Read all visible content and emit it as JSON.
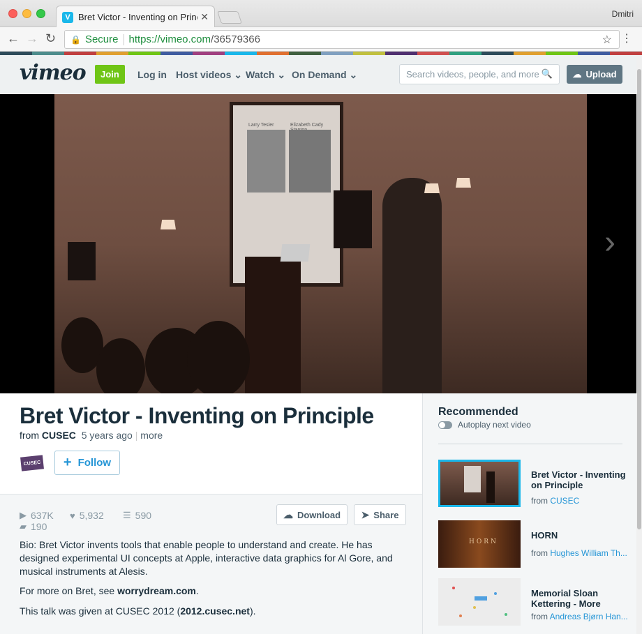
{
  "browser": {
    "tab_title": "Bret Victor - Inventing on Principle",
    "tab_favicon": "V",
    "user_name": "Dmitri",
    "secure_label": "Secure",
    "url_scheme_host": "https://vimeo.com",
    "url_path": "/36579366"
  },
  "header": {
    "logo": "vimeo",
    "join": "Join",
    "login": "Log in",
    "host_videos": "Host videos ⌄",
    "watch": "Watch ⌄",
    "on_demand": "On Demand ⌄",
    "search_placeholder": "Search videos, people, and more",
    "upload": "Upload"
  },
  "video": {
    "slide_caption_left": "Larry Tesler",
    "slide_caption_right": "Elizabeth Cady Stanton"
  },
  "info": {
    "title": "Bret Victor - Inventing on Principle",
    "from": "from",
    "channel": "CUSEC",
    "age": "5 years ago",
    "more": "more",
    "channel_logo_text": "CUSEC",
    "follow": "Follow"
  },
  "stats": {
    "plays": "637K",
    "likes": "5,932",
    "collections": "590",
    "comments": "190",
    "download": "Download",
    "share": "Share"
  },
  "description": {
    "bio": "Bio: Bret Victor invents tools that enable people to understand and create. He has designed experimental UI concepts at Apple, interactive data graphics for Al Gore, and musical instruments at Alesis.",
    "more_prefix": "For more on Bret, see ",
    "more_link": "worrydream.com",
    "more_suffix": ".",
    "talk_prefix": "This talk was given at CUSEC 2012 (",
    "talk_link": "2012.cusec.net",
    "talk_suffix": ")."
  },
  "recommended": {
    "title": "Recommended",
    "autoplay": "Autoplay next video",
    "items": [
      {
        "title": "Bret Victor - Inventing on Principle",
        "from": "from ",
        "author": "CUSEC"
      },
      {
        "title": "HORN",
        "from": "from ",
        "author": "Hughes William Th..."
      },
      {
        "title": "Memorial Sloan Kettering - More",
        "from": "from ",
        "author": "Andreas Bjørn Han..."
      }
    ],
    "horn_thumb_text": "HORN"
  },
  "colors": {
    "brand_green": "#6fc516",
    "link_blue": "#2495d6",
    "text_dark": "#1a2e3b",
    "stripe": [
      "#2d4b5a",
      "#4d8c8c",
      "#c04040",
      "#e0a030",
      "#6fc516",
      "#3f5ca0",
      "#a04080",
      "#1ab7ea",
      "#e07030",
      "#406040",
      "#80a0c0",
      "#c0c040",
      "#503070",
      "#d05050",
      "#30a080",
      "#2d4b5a",
      "#e0a030",
      "#6fc516",
      "#3f5ca0",
      "#c04040"
    ]
  }
}
